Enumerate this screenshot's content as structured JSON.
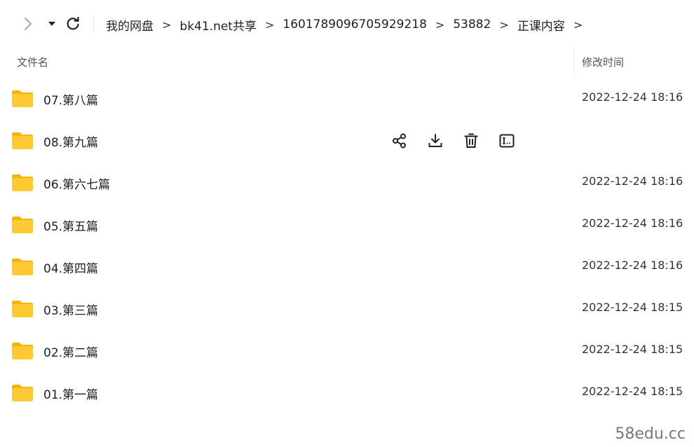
{
  "breadcrumb": [
    "我的网盘",
    "bk41.net共享",
    "1601789096705929218",
    "53882",
    "正课内容"
  ],
  "breadcrumb_separator": ">",
  "columns": {
    "name": "文件名",
    "modified": "修改时间"
  },
  "rows": [
    {
      "name": "07.第八篇",
      "time": "2022-12-24 18:16"
    },
    {
      "name": "08.第九篇",
      "time": ""
    },
    {
      "name": "06.第六七篇",
      "time": "2022-12-24 18:16"
    },
    {
      "name": "05.第五篇",
      "time": "2022-12-24 18:16"
    },
    {
      "name": "04.第四篇",
      "time": "2022-12-24 18:16"
    },
    {
      "name": "03.第三篇",
      "time": "2022-12-24 18:15"
    },
    {
      "name": "02.第二篇",
      "time": "2022-12-24 18:15"
    },
    {
      "name": "01.第一篇",
      "time": "2022-12-24 18:15"
    }
  ],
  "hover_row_actions": [
    "share-icon",
    "download-icon",
    "delete-icon",
    "rename-icon"
  ],
  "watermark": "58edu.cc",
  "colors": {
    "folder": "#FFC933",
    "folder_tab": "#F5B400",
    "text": "#1f1f1f",
    "muted": "#555555"
  }
}
